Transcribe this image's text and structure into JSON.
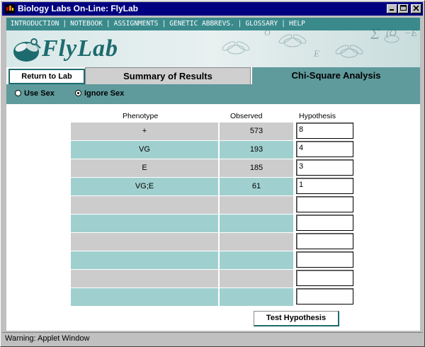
{
  "window": {
    "title": "Biology Labs On-Line: FlyLab",
    "controls": [
      "minimize",
      "maximize",
      "close"
    ]
  },
  "nav": {
    "items": [
      "INTRODUCTION",
      "NOTEBOOK",
      "ASSIGNMENTS",
      "GENETIC ABBREVS.",
      "GLOSSARY",
      "HELP"
    ],
    "separator": "|"
  },
  "logo": {
    "text": "FlyLab"
  },
  "tabs": {
    "return_label": "Return to Lab",
    "summary_label": "Summary of Results",
    "chi_label": "Chi-Square Analysis",
    "active": "Chi-Square Analysis"
  },
  "options": {
    "use_sex": "Use Sex",
    "ignore_sex": "Ignore Sex",
    "selected": "Ignore Sex"
  },
  "table": {
    "headers": [
      "Phenotype",
      "Observed",
      "Hypothesis"
    ],
    "rows": [
      {
        "phenotype": "+",
        "observed": "573",
        "hypothesis": "8"
      },
      {
        "phenotype": "VG",
        "observed": "193",
        "hypothesis": "4"
      },
      {
        "phenotype": "E",
        "observed": "185",
        "hypothesis": "3"
      },
      {
        "phenotype": "VG;E",
        "observed": "61",
        "hypothesis": "1"
      },
      {
        "phenotype": "",
        "observed": "",
        "hypothesis": ""
      },
      {
        "phenotype": "",
        "observed": "",
        "hypothesis": ""
      },
      {
        "phenotype": "",
        "observed": "",
        "hypothesis": ""
      },
      {
        "phenotype": "",
        "observed": "",
        "hypothesis": ""
      },
      {
        "phenotype": "",
        "observed": "",
        "hypothesis": ""
      },
      {
        "phenotype": "",
        "observed": "",
        "hypothesis": ""
      }
    ]
  },
  "test_button": "Test Hypothesis",
  "status": "Warning: Applet Window",
  "colors": {
    "titlebar": "#000080",
    "teal_dark": "#5f9a9c",
    "teal_light": "#9fd0cf",
    "gray_row": "#cccccc",
    "nav_bg": "#3a8a8c",
    "logo_text": "#1d6b6e"
  }
}
